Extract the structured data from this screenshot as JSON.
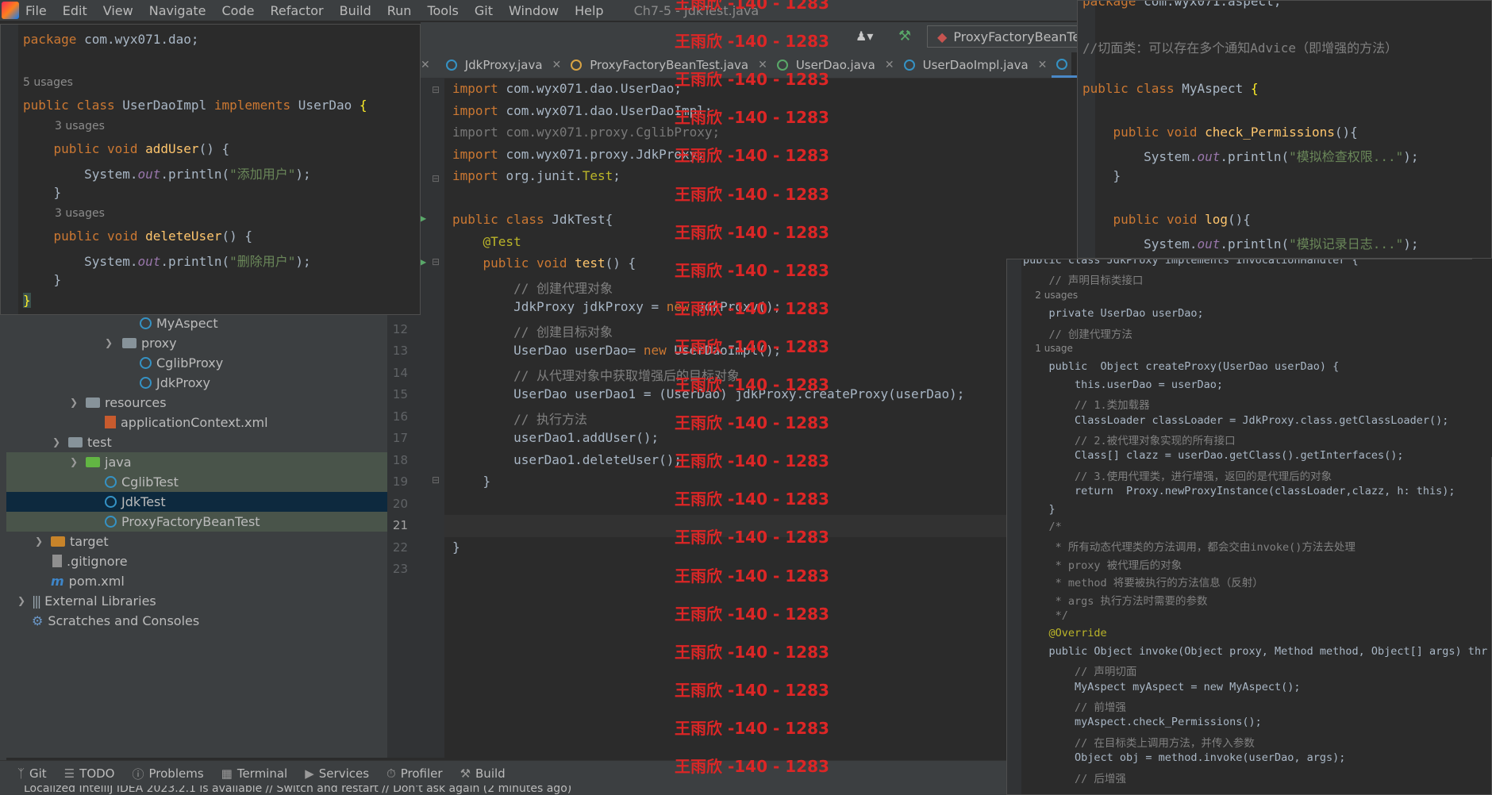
{
  "menu": {
    "items": [
      "File",
      "Edit",
      "View",
      "Navigate",
      "Code",
      "Refactor",
      "Build",
      "Run",
      "Tools",
      "Git",
      "Window",
      "Help"
    ],
    "window_title": "Ch7-5 - JdkTest.java"
  },
  "toolbar": {
    "run_config": "ProxyFactoryBeanTe"
  },
  "tabs": [
    {
      "label": "JdkProxy.java",
      "kind": "class"
    },
    {
      "label": "ProxyFactoryBeanTest.java",
      "kind": "test"
    },
    {
      "label": "UserDao.java",
      "kind": "interface"
    },
    {
      "label": "UserDaoImpl.java",
      "kind": "class"
    }
  ],
  "project_tree": [
    {
      "label": "MyAspect",
      "icon": "class"
    },
    {
      "label": "proxy",
      "icon": "package"
    },
    {
      "label": "CglibProxy",
      "icon": "class"
    },
    {
      "label": "JdkProxy",
      "icon": "class"
    },
    {
      "label": "resources",
      "icon": "folder"
    },
    {
      "label": "applicationContext.xml",
      "icon": "xml"
    },
    {
      "label": "test",
      "icon": "folder"
    },
    {
      "label": "java",
      "icon": "test-root"
    },
    {
      "label": "CglibTest",
      "icon": "class"
    },
    {
      "label": "JdkTest",
      "icon": "class"
    },
    {
      "label": "ProxyFactoryBeanTest",
      "icon": "class"
    },
    {
      "label": "target",
      "icon": "excluded-folder"
    },
    {
      "label": ".gitignore",
      "icon": "git"
    },
    {
      "label": "pom.xml",
      "icon": "maven"
    },
    {
      "label": "External Libraries",
      "icon": "libraries"
    },
    {
      "label": "Scratches and Consoles",
      "icon": "scratches"
    }
  ],
  "line_numbers": [
    "12",
    "13",
    "14",
    "15",
    "16",
    "17",
    "18",
    "19",
    "20",
    "21",
    "22",
    "23"
  ],
  "current_line": "21",
  "editor_main": {
    "lines": [
      "import com.wyx071.dao.UserDao;",
      "import com.wyx071.dao.UserDaoImpl;",
      "import com.wyx071.proxy.CglibProxy;",
      "import com.wyx071.proxy.JdkProxy;",
      "import org.junit.Test;",
      "",
      "public class JdkTest{",
      "    @Test",
      "    public void test() {",
      "        // 创建代理对象",
      "        JdkProxy jdkProxy = new JdkProxy();",
      "        // 创建目标对象",
      "        UserDao userDao= new UserDaoImpl();",
      "        // 从代理对象中获取增强后的目标对象",
      "        UserDao userDao1 = (UserDao) jdkProxy.createProxy(userDao);",
      "        // 执行方法",
      "        userDao1.addUser();",
      "        userDao1.deleteUser();",
      "    }",
      "",
      "",
      "}",
      ""
    ]
  },
  "popup_userdaoimpl": {
    "package_line": "package com.wyx071.dao;",
    "usages_5": "5 usages",
    "class_line": "public class UserDaoImpl implements UserDao {",
    "usages_3a": "3 usages",
    "adduser_line": "    public void addUser() {",
    "adduser_print": "        System.out.println(\"添加用户\");",
    "close1": "    }",
    "usages_3b": "3 usages",
    "deleteuser_line": "    public void deleteUser() {",
    "deleteuser_print": "        System.out.println(\"删除用户\");",
    "close2": "    }",
    "close3": "}"
  },
  "popup_myaspect": {
    "package_line": "package com.wyx071.aspect;",
    "comment": "//切面类：可以存在多个通知Advice（即增强的方法）",
    "class_line": "public class MyAspect {",
    "check_line": "    public void check_Permissions(){",
    "check_print": "        System.out.println(\"模拟检查权限...\");",
    "close1": "    }",
    "log_line": "    public void log(){",
    "log_print": "        System.out.println(\"模拟记录日志...\");"
  },
  "popup_jdkproxy": {
    "lines": [
      "public class JdkProxy implements InvocationHandler {",
      "    // 声明目标类接口",
      "    2 usages",
      "    private UserDao userDao;",
      "    // 创建代理方法",
      "    1 usage",
      "    public  Object createProxy(UserDao userDao) {",
      "        this.userDao = userDao;",
      "        // 1.类加载器",
      "        ClassLoader classLoader = JdkProxy.class.getClassLoader();",
      "        // 2.被代理对象实现的所有接口",
      "        Class[] clazz = userDao.getClass().getInterfaces();",
      "        // 3.使用代理类，进行增强，返回的是代理后的对象",
      "        return  Proxy.newProxyInstance(classLoader,clazz, h: this);",
      "    }",
      "    /*",
      "     * 所有动态代理类的方法调用，都会交由invoke()方法去处理",
      "     * proxy 被代理后的对象",
      "     * method 将要被执行的方法信息（反射）",
      "     * args 执行方法时需要的参数",
      "     */",
      "    @Override",
      "    public Object invoke(Object proxy, Method method, Object[] args) thr",
      "        // 声明切面",
      "        MyAspect myAspect = new MyAspect();",
      "        // 前增强",
      "        myAspect.check_Permissions();",
      "        // 在目标类上调用方法，并传入参数",
      "        Object obj = method.invoke(userDao, args);",
      "        // 后增强"
    ]
  },
  "tool_windows": [
    "Git",
    "TODO",
    "Problems",
    "Terminal",
    "Services",
    "Profiler",
    "Build"
  ],
  "status": {
    "message": "Localized IntelliJ IDEA 2023.2.1 is available // Switch and restart // Don't ask again (2 minutes ago)"
  },
  "watermark": {
    "text": "王雨欣 -140 - 1283",
    "color": "#dc2626"
  }
}
